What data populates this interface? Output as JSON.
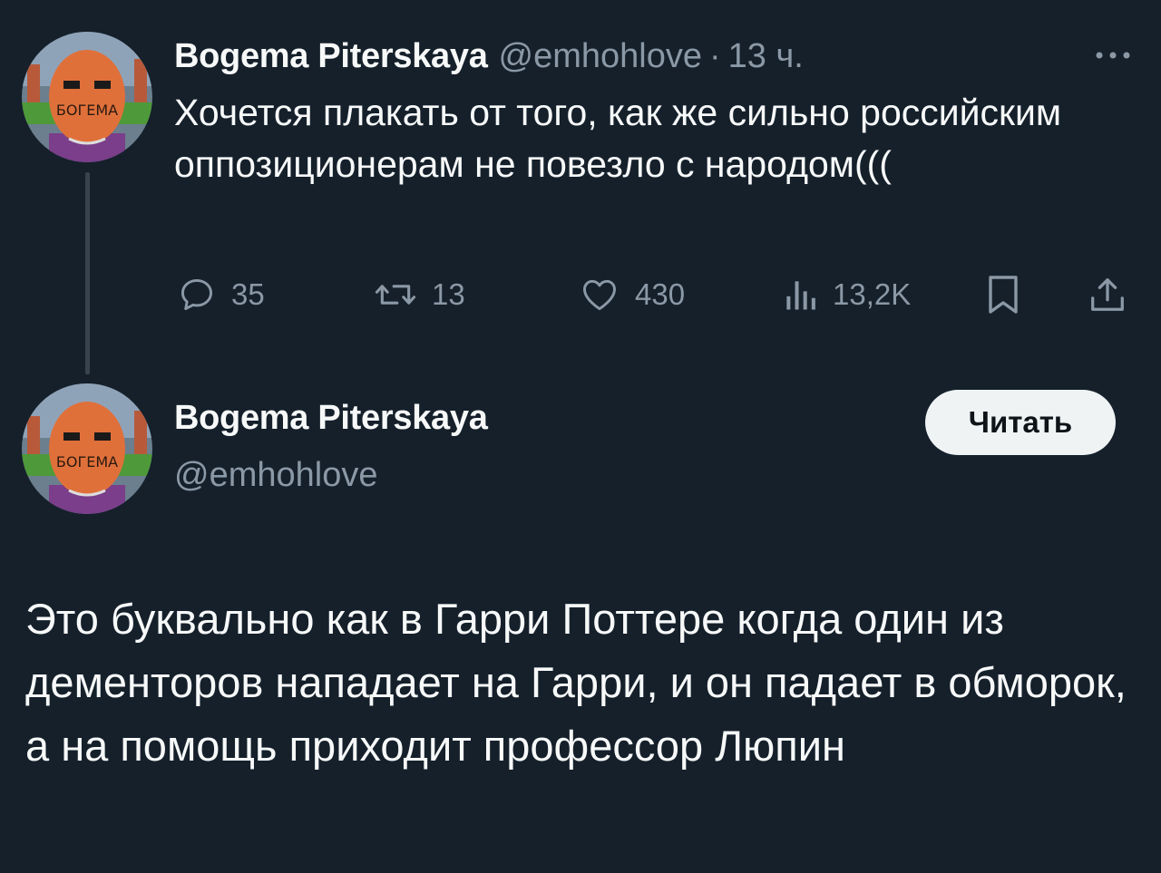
{
  "tweet": {
    "display_name": "Bogema Piterskaya",
    "handle": "@emhohlove",
    "separator": "·",
    "time": "13 ч.",
    "text": "Хочется плакать от того, как же сильно российским оппозиционерам не повезло с народом(((",
    "avatar_text": "БОГЕМА",
    "actions": {
      "replies": "35",
      "retweets": "13",
      "likes": "430",
      "views": "13,2K"
    },
    "icons": {
      "more": "more-dots-icon",
      "reply": "reply-bubble-icon",
      "retweet": "retweet-arrows-icon",
      "like": "heart-icon",
      "views": "views-bars-icon",
      "bookmark": "bookmark-icon",
      "share": "share-upload-icon"
    }
  },
  "profile_card": {
    "display_name": "Bogema Piterskaya",
    "handle": "@emhohlove",
    "follow_label": "Читать",
    "avatar_text": "БОГЕМА",
    "bio": "Это буквально как в Гарри Поттере когда один из дементоров нападает на Гарри, и он падает в обморок, а на помощь приходит профессор Люпин"
  },
  "colors": {
    "background": "#15202b",
    "text_primary": "#f7f9f9",
    "text_secondary": "#8b98a5",
    "thread_line": "#38444d",
    "button_bg": "#eff3f4",
    "button_text": "#0f1419",
    "avatar_orange": "#e0703a"
  }
}
